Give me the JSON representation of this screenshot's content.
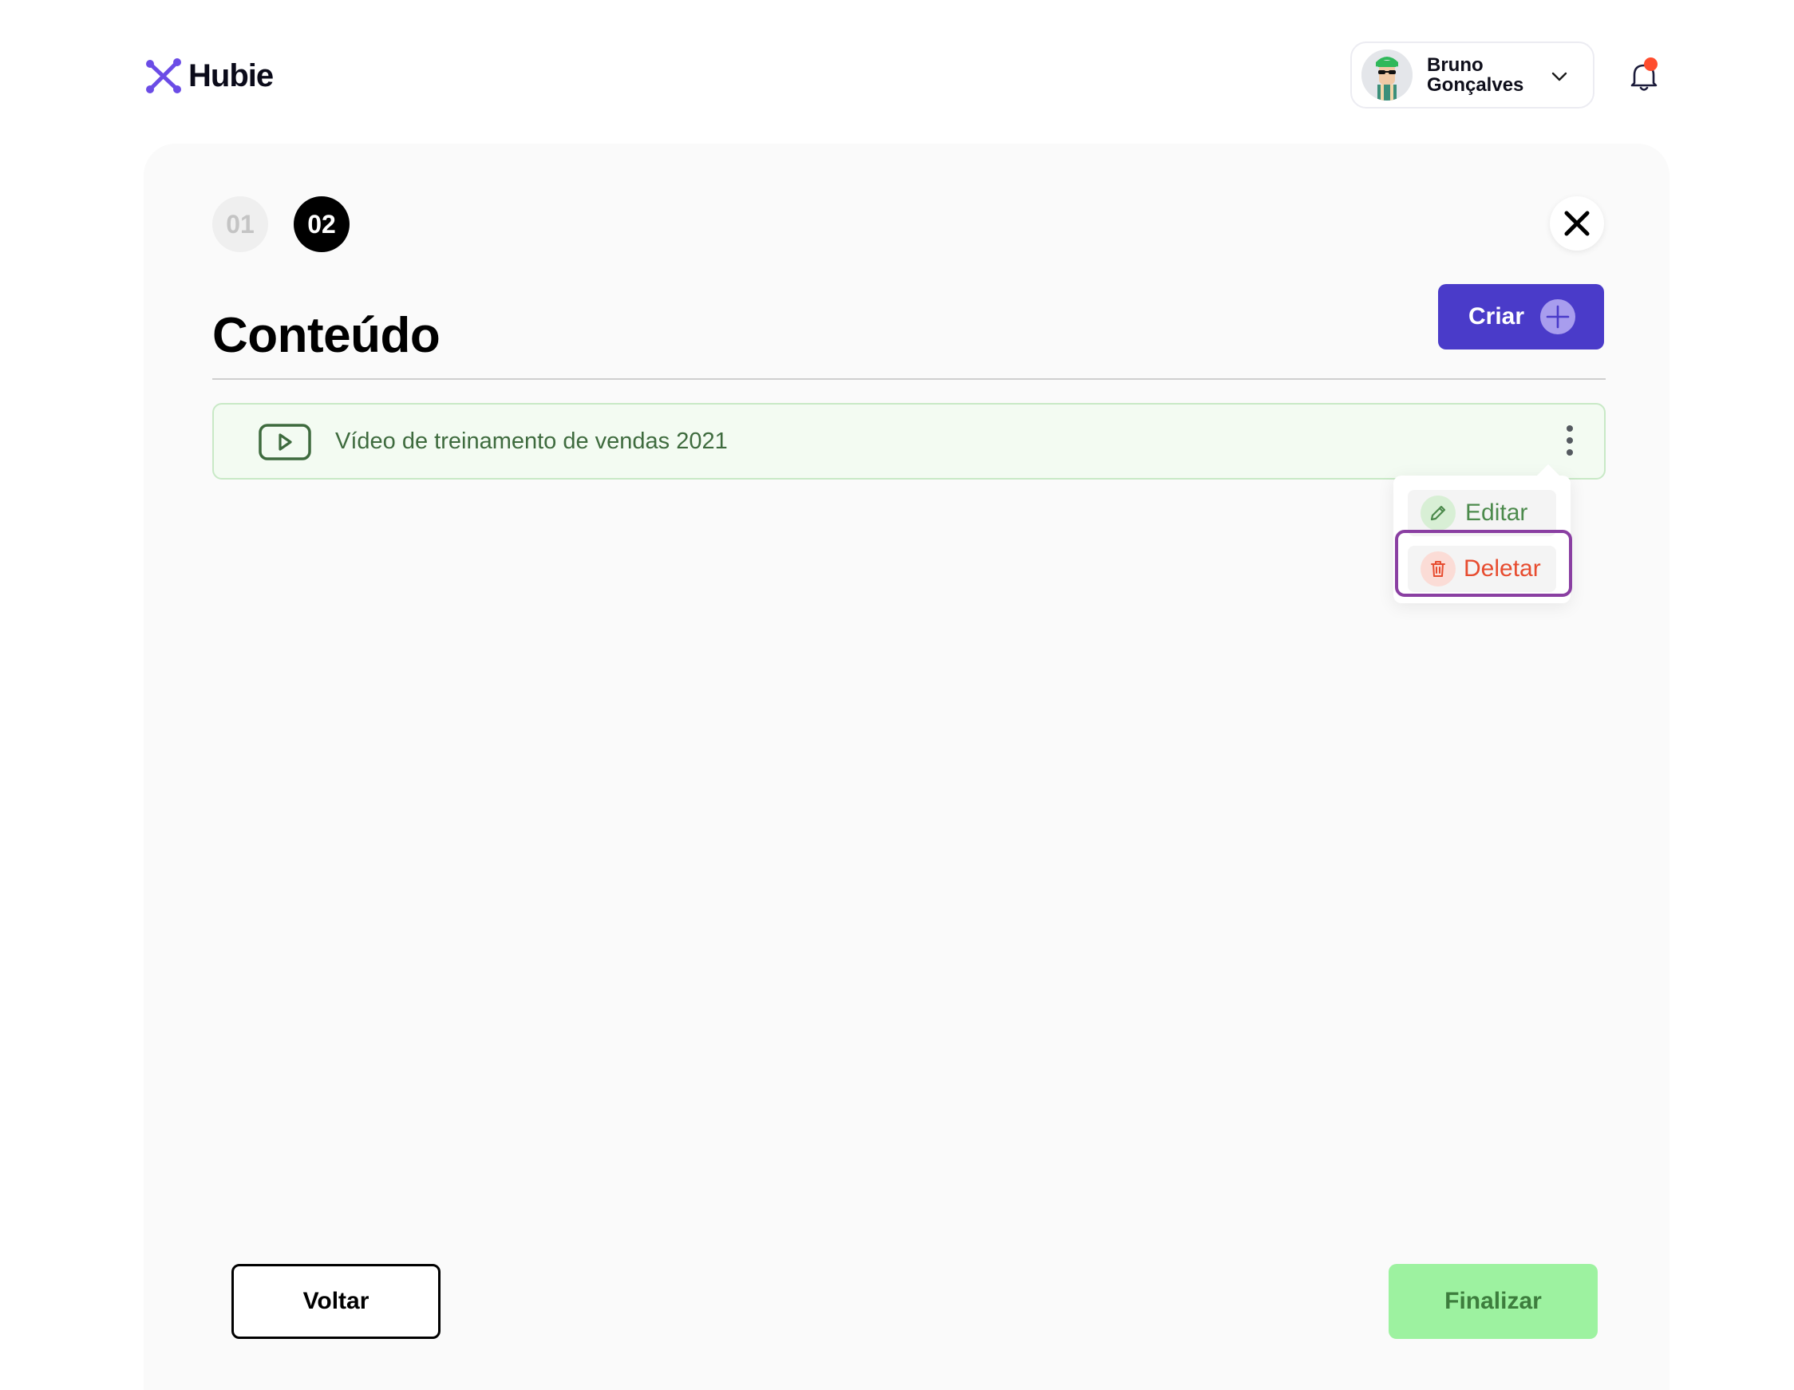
{
  "header": {
    "brand_name": "Hubie",
    "user": {
      "first_name": "Bruno",
      "last_name": "Gonçalves"
    },
    "notifications_unread": true
  },
  "steps": {
    "step1_label": "01",
    "step2_label": "02",
    "active_step": 2
  },
  "main": {
    "title": "Conteúdo",
    "create_label": "Criar",
    "content_items": [
      {
        "title": "Vídeo de treinamento de vendas 2021",
        "type": "video"
      }
    ]
  },
  "item_menu": {
    "edit_label": "Editar",
    "delete_label": "Deletar"
  },
  "footer": {
    "back_label": "Voltar",
    "finish_label": "Finalizar"
  },
  "colors": {
    "brand_accent": "#4a3bc9",
    "logo_purple": "#6b4ce6",
    "success_green": "#9df2a0",
    "danger_red": "#e74c2f",
    "highlight_purple": "#8a3fa2"
  },
  "icons": {
    "logo": "hubie-logo-icon",
    "user_menu": "chevron-down-icon",
    "notifications": "bell-icon",
    "close": "close-icon",
    "create": "plus-icon",
    "content_type": "video-play-icon",
    "item_actions": "kebab-icon",
    "edit": "pencil-icon",
    "delete": "trash-icon"
  }
}
